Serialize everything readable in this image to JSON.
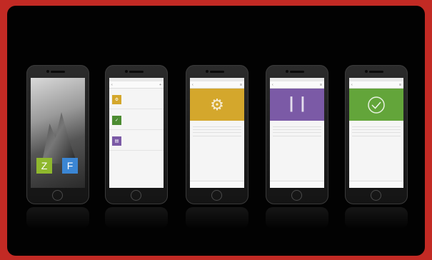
{
  "colors": {
    "background_red": "#c22a24",
    "frame": "#020202",
    "yellow": "#d4a72c",
    "purple": "#7b5aa6",
    "green": "#63a53a"
  },
  "phone1": {
    "tile_z": "Z",
    "tile_f": "F"
  },
  "phone2": {
    "title": "",
    "icons": [
      "gear-icon",
      "check-icon",
      "file-icon"
    ]
  },
  "phone3": {
    "icon": "gears-icon"
  },
  "phone4": {
    "icon": "lines-icon"
  },
  "phone5": {
    "icon": "check-circle-icon"
  }
}
